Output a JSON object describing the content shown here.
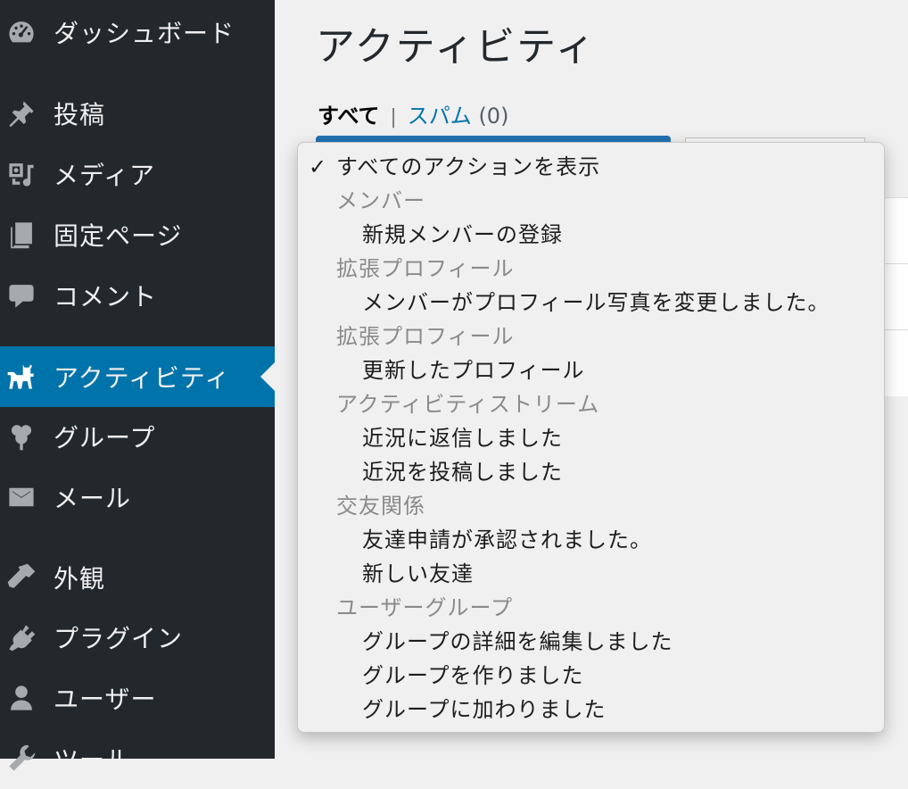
{
  "sidebar": {
    "items": [
      {
        "label": "ダッシュボード",
        "icon": "dashboard-icon"
      },
      {
        "label": "投稿",
        "icon": "pin-icon"
      },
      {
        "label": "メディア",
        "icon": "media-icon"
      },
      {
        "label": "固定ページ",
        "icon": "pages-icon"
      },
      {
        "label": "コメント",
        "icon": "comment-icon"
      },
      {
        "label": "アクティビティ",
        "icon": "activity-icon",
        "active": true
      },
      {
        "label": "グループ",
        "icon": "groups-icon"
      },
      {
        "label": "メール",
        "icon": "email-icon"
      },
      {
        "label": "外観",
        "icon": "appearance-icon"
      },
      {
        "label": "プラグイン",
        "icon": "plugin-icon"
      },
      {
        "label": "ユーザー",
        "icon": "user-icon"
      },
      {
        "label": "ツール",
        "icon": "tools-icon"
      }
    ],
    "colors": {
      "background": "#23282d",
      "active": "#0073aa"
    }
  },
  "main": {
    "title": "アクティビティ",
    "filters": {
      "all": "すべて",
      "separator": "|",
      "spam": "スパム",
      "spam_count": "(0)"
    }
  },
  "dropdown": {
    "selected": {
      "check": "✓",
      "label": "すべてのアクションを表示"
    },
    "options": [
      {
        "kind": "group",
        "label": "メンバー"
      },
      {
        "kind": "item",
        "label": "新規メンバーの登録"
      },
      {
        "kind": "group",
        "label": "拡張プロフィール"
      },
      {
        "kind": "item",
        "label": "メンバーがプロフィール写真を変更しました。"
      },
      {
        "kind": "group",
        "label": "拡張プロフィール"
      },
      {
        "kind": "item",
        "label": "更新したプロフィール"
      },
      {
        "kind": "group",
        "label": "アクティビティストリーム"
      },
      {
        "kind": "item",
        "label": "近況に返信しました"
      },
      {
        "kind": "item",
        "label": "近況を投稿しました"
      },
      {
        "kind": "group",
        "label": "交友関係"
      },
      {
        "kind": "item",
        "label": "友達申請が承認されました。"
      },
      {
        "kind": "item",
        "label": "新しい友達"
      },
      {
        "kind": "group",
        "label": "ユーザーグループ"
      },
      {
        "kind": "item",
        "label": "グループの詳細を編集しました"
      },
      {
        "kind": "item",
        "label": "グループを作りました"
      },
      {
        "kind": "item",
        "label": "グループに加わりました"
      }
    ]
  }
}
